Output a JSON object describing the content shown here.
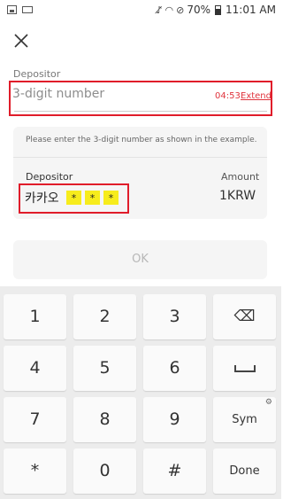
{
  "status_bar": {
    "battery": "70%",
    "time": "11:01 AM"
  },
  "form": {
    "label": "Depositor",
    "placeholder": "3-digit number",
    "timer": "04:53",
    "extend_label": "Extend"
  },
  "example": {
    "hint": "Please enter the 3-digit number as shown in the example.",
    "depositor_header": "Depositor",
    "amount_header": "Amount",
    "depositor_name": "카카오",
    "masked": [
      "*",
      "*",
      "*"
    ],
    "amount": "1KRW"
  },
  "ok_label": "OK",
  "keys": {
    "k1": "1",
    "k2": "2",
    "k3": "3",
    "backspace": "⌫",
    "k4": "4",
    "k5": "5",
    "k6": "6",
    "k7": "7",
    "k8": "8",
    "k9": "9",
    "sym": "Sym",
    "star": "*",
    "k0": "0",
    "hash": "#",
    "done": "Done"
  }
}
